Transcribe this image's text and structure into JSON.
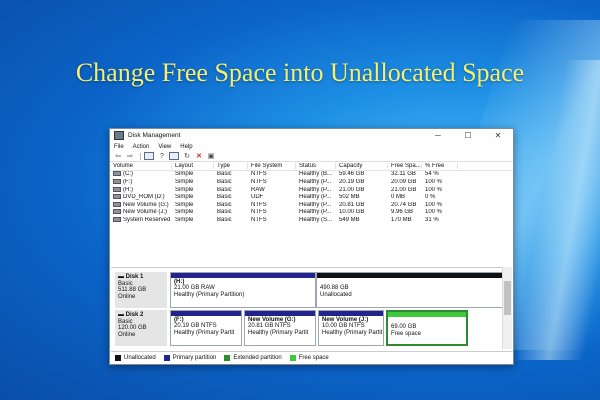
{
  "headline": "Change Free Space into Unallocated Space",
  "window": {
    "title": "Disk Management",
    "controls": {
      "minimize": "─",
      "maximize": "☐",
      "close": "✕"
    }
  },
  "menu": [
    "File",
    "Action",
    "View",
    "Help"
  ],
  "toolbar_icons": [
    "back-icon",
    "forward-icon",
    "disk-list-icon",
    "help-icon",
    "properties-icon",
    "refresh-icon",
    "delete-icon",
    "settings-icon"
  ],
  "columns": [
    "Volume",
    "Layout",
    "Type",
    "File System",
    "Status",
    "Capacity",
    "Free Spa...",
    "% Free"
  ],
  "volumes": [
    [
      "(C:)",
      "Simple",
      "Basic",
      "NTFS",
      "Healthy (B...",
      "59.46 GB",
      "32.11 GB",
      "54 %"
    ],
    [
      "(F:)",
      "Simple",
      "Basic",
      "NTFS",
      "Healthy (P...",
      "20.19 GB",
      "20.09 GB",
      "100 %"
    ],
    [
      "(H:)",
      "Simple",
      "Basic",
      "RAW",
      "Healthy (P...",
      "21.00 GB",
      "21.00 GB",
      "100 %"
    ],
    [
      "DVD_ROM (D:)",
      "Simple",
      "Basic",
      "UDF",
      "Healthy (P...",
      "502 MB",
      "0 MB",
      "0 %"
    ],
    [
      "New Volume (G:)",
      "Simple",
      "Basic",
      "NTFS",
      "Healthy (P...",
      "20.81 GB",
      "20.74 GB",
      "100 %"
    ],
    [
      "New Volume (J:)",
      "Simple",
      "Basic",
      "NTFS",
      "Healthy (P...",
      "10.00 GB",
      "9.96 GB",
      "100 %"
    ],
    [
      "System Reserved",
      "Simple",
      "Basic",
      "NTFS",
      "Healthy (S...",
      "549 MB",
      "170 MB",
      "31 %"
    ]
  ],
  "disk1": {
    "name": "Disk 1",
    "type": "Basic",
    "size": "511.88 GB",
    "status": "Online",
    "partitions": [
      {
        "title": "(H:)",
        "size": "21.00 GB RAW",
        "status": "Healthy (Primary Partition)"
      },
      {
        "title": "",
        "size": "490.88 GB",
        "status": "Unallocated"
      }
    ]
  },
  "disk2": {
    "name": "Disk 2",
    "type": "Basic",
    "size": "120.00 GB",
    "status": "Online",
    "partitions": [
      {
        "title": "(F:)",
        "size": "20.19 GB NTFS",
        "status": "Healthy (Primary Partit"
      },
      {
        "title": "New Volume (G:)",
        "size": "20.81 GB NTFS",
        "status": "Healthy (Primary Partit"
      },
      {
        "title": "New Volume (J:)",
        "size": "10.00 GB NTFS",
        "status": "Healthy (Primary Partit"
      },
      {
        "title": "",
        "size": "69.00 GB",
        "status": "Free space"
      }
    ]
  },
  "legend": [
    {
      "label": "Unallocated",
      "color": "#111111"
    },
    {
      "label": "Primary partition",
      "color": "#23238e"
    },
    {
      "label": "Extended partition",
      "color": "#2e8b2e"
    },
    {
      "label": "Free space",
      "color": "#3ec93e"
    }
  ]
}
